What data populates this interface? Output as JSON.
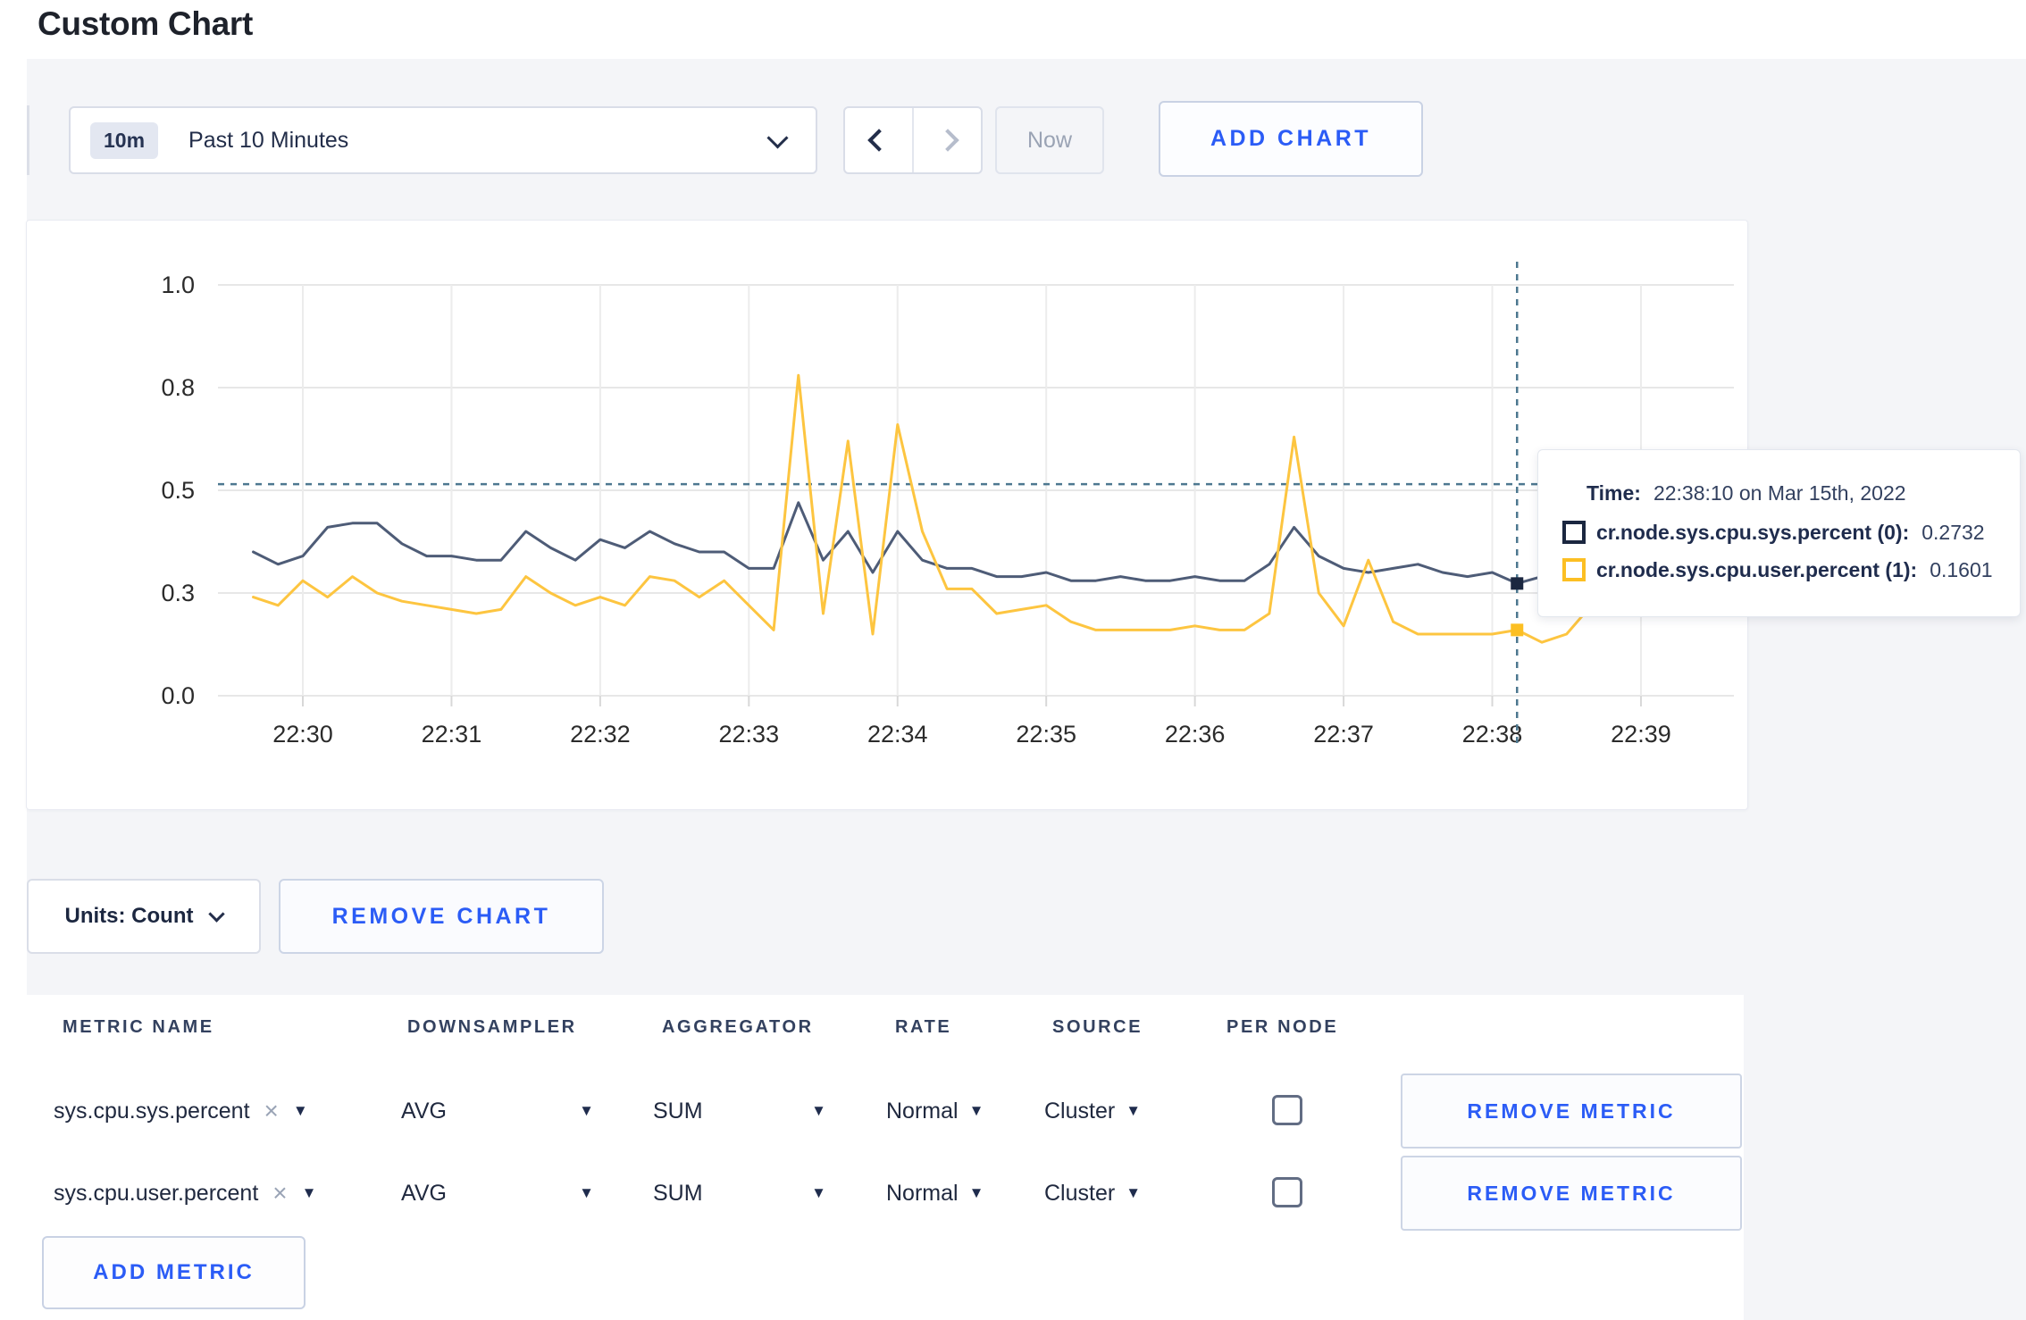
{
  "page": {
    "title": "Custom Chart"
  },
  "toolbar": {
    "range_badge": "10m",
    "range_label": "Past 10 Minutes",
    "now_label": "Now",
    "add_chart_label": "ADD CHART"
  },
  "icons": {
    "caret_down": "▼",
    "clear": "×"
  },
  "tooltip": {
    "time_label": "Time:",
    "time_value": "22:38:10 on Mar 15th, 2022",
    "series": [
      {
        "label": "cr.node.sys.cpu.sys.percent (0):",
        "value": "0.2732",
        "color": "#1b2740"
      },
      {
        "label": "cr.node.sys.cpu.user.percent (1):",
        "value": "0.1601",
        "color": "#fcbf23"
      }
    ]
  },
  "chart_controls": {
    "units_label": "Units: Count",
    "remove_chart_label": "REMOVE CHART"
  },
  "metrics_table": {
    "headers": [
      "METRIC NAME",
      "DOWNSAMPLER",
      "AGGREGATOR",
      "RATE",
      "SOURCE",
      "PER NODE"
    ],
    "add_metric_label": "ADD METRIC",
    "rows": [
      {
        "metric": "sys.cpu.sys.percent",
        "downsampler": "AVG",
        "aggregator": "SUM",
        "rate": "Normal",
        "source": "Cluster",
        "per_node": false,
        "remove_label": "REMOVE METRIC"
      },
      {
        "metric": "sys.cpu.user.percent",
        "downsampler": "AVG",
        "aggregator": "SUM",
        "rate": "Normal",
        "source": "Cluster",
        "per_node": false,
        "remove_label": "REMOVE METRIC"
      }
    ]
  },
  "chart_data": {
    "type": "line",
    "title": "",
    "xlabel": "",
    "ylabel": "",
    "ylim": [
      0,
      1
    ],
    "grid": true,
    "legend_position": "none",
    "y_axis": {
      "min": 0,
      "max": 1,
      "ticks": [
        {
          "value": 0,
          "label": "0.0"
        },
        {
          "value": 0.25,
          "label": "0.3"
        },
        {
          "value": 0.5,
          "label": "0.5"
        },
        {
          "value": 0.75,
          "label": "0.8"
        },
        {
          "value": 1,
          "label": "1.0"
        }
      ]
    },
    "x_axis": {
      "tick_labels": [
        "22:30",
        "22:31",
        "22:32",
        "22:33",
        "22:34",
        "22:35",
        "22:36",
        "22:37",
        "22:38",
        "22:39"
      ],
      "start_label": "22:29:40",
      "start_offset_seconds": -20,
      "step_seconds": 10
    },
    "hover": {
      "index": 51,
      "time": "22:38:10",
      "crosshair_value": 0.515
    },
    "series": [
      {
        "name": "cr.node.sys.cpu.sys.percent",
        "color": "#4e5c77",
        "swatch_color": "#1b2740",
        "values": [
          0.35,
          0.32,
          0.34,
          0.41,
          0.42,
          0.42,
          0.37,
          0.34,
          0.34,
          0.33,
          0.33,
          0.4,
          0.36,
          0.33,
          0.38,
          0.36,
          0.4,
          0.37,
          0.35,
          0.35,
          0.31,
          0.31,
          0.47,
          0.33,
          0.4,
          0.3,
          0.4,
          0.33,
          0.31,
          0.31,
          0.29,
          0.29,
          0.3,
          0.28,
          0.28,
          0.29,
          0.28,
          0.28,
          0.29,
          0.28,
          0.28,
          0.32,
          0.41,
          0.34,
          0.31,
          0.3,
          0.31,
          0.32,
          0.3,
          0.29,
          0.3,
          0.2732,
          0.29,
          0.3,
          0.31,
          0.3,
          0.31,
          0.3
        ]
      },
      {
        "name": "cr.node.sys.cpu.user.percent",
        "color": "#fdc540",
        "swatch_color": "#fcbf23",
        "values": [
          0.24,
          0.22,
          0.28,
          0.24,
          0.29,
          0.25,
          0.23,
          0.22,
          0.21,
          0.2,
          0.21,
          0.29,
          0.25,
          0.22,
          0.24,
          0.22,
          0.29,
          0.28,
          0.24,
          0.28,
          0.22,
          0.16,
          0.78,
          0.2,
          0.62,
          0.15,
          0.66,
          0.4,
          0.26,
          0.26,
          0.2,
          0.21,
          0.22,
          0.18,
          0.16,
          0.16,
          0.16,
          0.16,
          0.17,
          0.16,
          0.16,
          0.2,
          0.63,
          0.25,
          0.17,
          0.33,
          0.18,
          0.15,
          0.15,
          0.15,
          0.15,
          0.1601,
          0.13,
          0.15,
          0.22,
          0.33,
          0.26,
          0.24
        ]
      }
    ]
  }
}
